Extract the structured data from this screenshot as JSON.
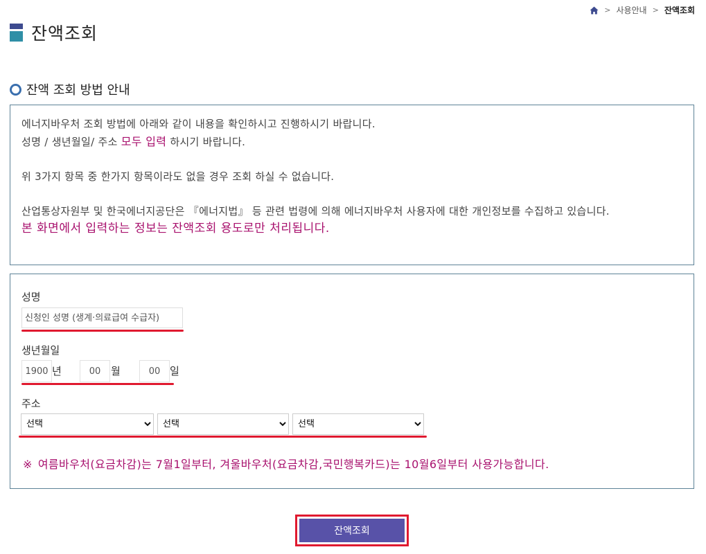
{
  "breadcrumb": {
    "home_icon": "home-icon",
    "separator": ">",
    "items": [
      "사용안내",
      "잔액조회"
    ]
  },
  "page": {
    "title": "잔액조회"
  },
  "guide": {
    "title": "잔액 조회 방법 안내",
    "line1": "에너지바우처 조회 방법에 아래와 같이 내용을 확인하시고 진행하시기 바랍니다.",
    "line2_prefix": "성명 / 생년월일/ 주소 ",
    "line2_highlight": "모두 입력",
    "line2_suffix": " 하시기 바랍니다.",
    "line3": "위 3가지 항목 중 한가지 항목이라도 없을 경우 조회 하실 수 없습니다.",
    "line4": "산업통상자원부 및 한국에너지공단은 『에너지법』 등 관련 법령에 의해 에너지바우처 사용자에 대한 개인정보를 수집하고 있습니다.",
    "line5": "본 화면에서 입력하는 정보는 잔액조회 용도로만 처리됩니다."
  },
  "form": {
    "name_label": "성명",
    "name_placeholder": "신청인 성명 (생계·의료급여 수급자)",
    "birth_label": "생년월일",
    "year_value": "1900",
    "year_unit": "년",
    "month_value": "00",
    "month_unit": "월",
    "day_value": "00",
    "day_unit": "일",
    "address_label": "주소",
    "select_1": "선택",
    "select_2": "선택",
    "select_3": "선택",
    "notice_mark": "※",
    "notice": "여름바우처(요금차감)는 7월1일부터, 겨울바우처(요금차감,국민행복카드)는 10월6일부터 사용가능합니다."
  },
  "submit_label": "잔액조회",
  "colors": {
    "accent": "#5852a8",
    "highlight": "#a8106d",
    "annotation_red": "#e0192f",
    "border": "#5d8297"
  }
}
